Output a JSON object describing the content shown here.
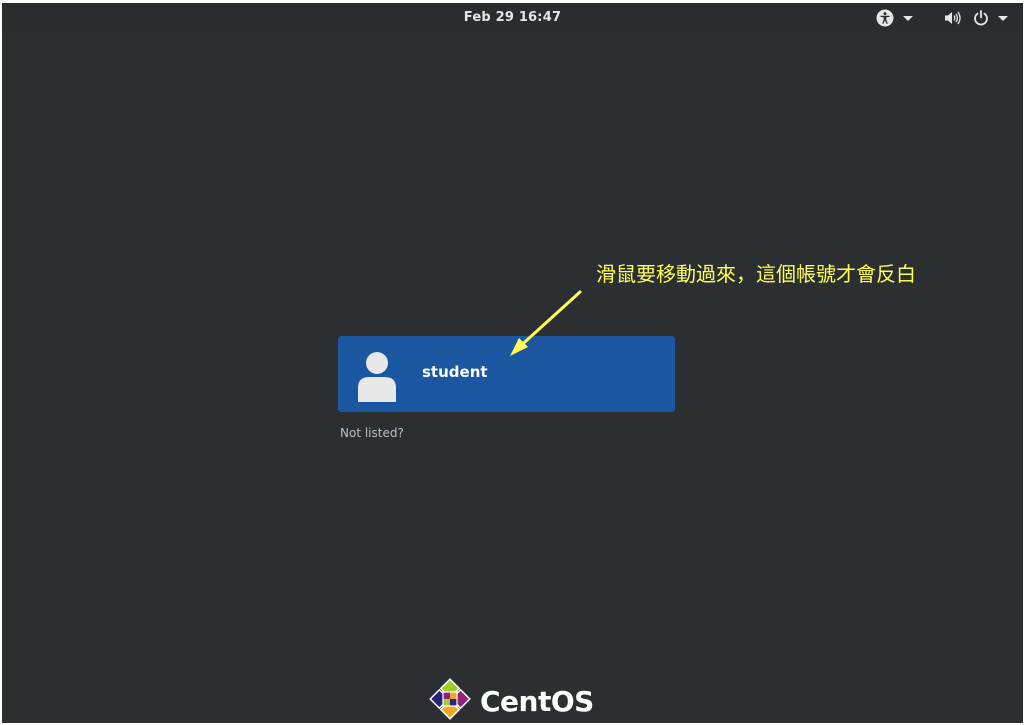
{
  "topbar": {
    "datetime": "Feb 29  16:47",
    "icons": [
      "accessibility-icon",
      "volume-icon",
      "power-icon"
    ]
  },
  "login": {
    "users": [
      {
        "name": "student",
        "icon": "user-avatar-icon"
      }
    ],
    "not_listed_label": "Not listed?"
  },
  "annotation": {
    "text": "滑鼠要移動過來，這個帳號才會反白",
    "color": "#ffff55"
  },
  "branding": {
    "logo_text": "CentOS"
  },
  "colors": {
    "background": "#2c2f32",
    "selected_user": "#1b56a0"
  }
}
